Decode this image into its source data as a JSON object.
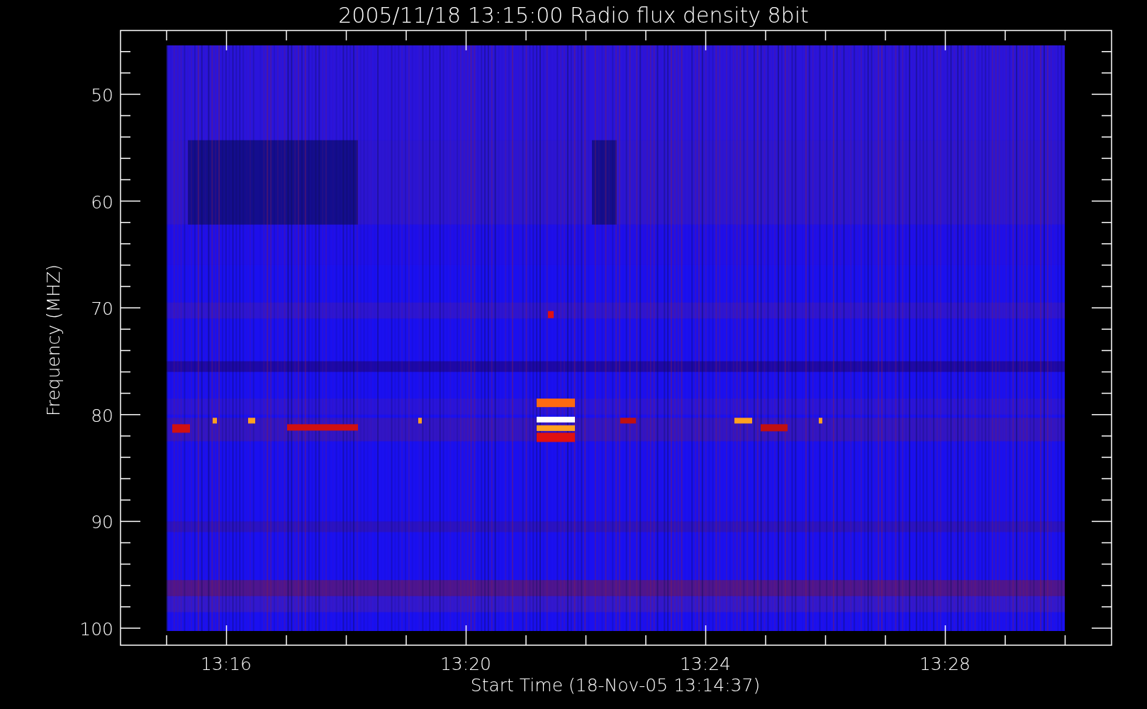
{
  "title": "2005/11/18 13:15:00 Radio flux density 8bit",
  "y_axis": {
    "label": "Frequency (MHZ)",
    "ticks": [
      "50",
      "60",
      "70",
      "80",
      "90",
      "100"
    ]
  },
  "x_axis": {
    "label": "Start Time (18-Nov-05 13:14:37)",
    "ticks": [
      "13:16",
      "13:20",
      "13:24",
      "13:28"
    ]
  }
}
